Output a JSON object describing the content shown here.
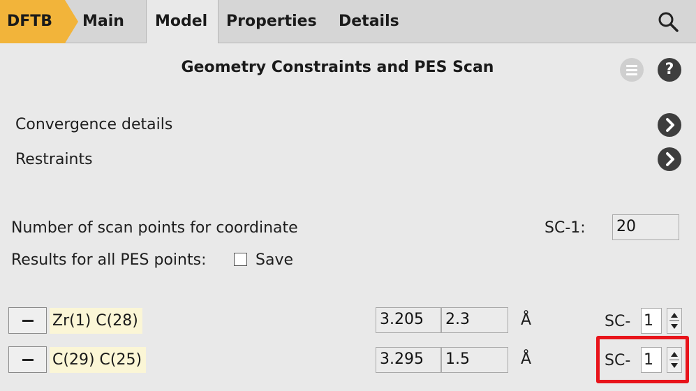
{
  "tabs": {
    "engine": "DFTB",
    "main": "Main",
    "model": "Model",
    "properties": "Properties",
    "details": "Details"
  },
  "panel": {
    "title": "Geometry Constraints and PES Scan",
    "help_label": "?"
  },
  "sections": {
    "convergence": "Convergence details",
    "restraints": "Restraints"
  },
  "scan": {
    "points_label": "Number of scan points for coordinate",
    "coord_label": "SC-1:",
    "points_value": "20",
    "results_label": "Results for all PES points:",
    "save_label": "Save",
    "save_checked": false
  },
  "constraints": [
    {
      "atoms": "Zr(1) C(28)",
      "start": "3.205",
      "end": "2.3",
      "unit": "Å",
      "sc_prefix": "SC-",
      "sc_value": "1"
    },
    {
      "atoms": "C(29) C(25)",
      "start": "3.295",
      "end": "1.5",
      "unit": "Å",
      "sc_prefix": "SC-",
      "sc_value": "1"
    }
  ],
  "colors": {
    "accent": "#f2b43a",
    "tabbar": "#d6d6d6",
    "panel": "#e9e9e9",
    "highlight": "#e8141b",
    "atom_bg": "#fbf6d6"
  }
}
